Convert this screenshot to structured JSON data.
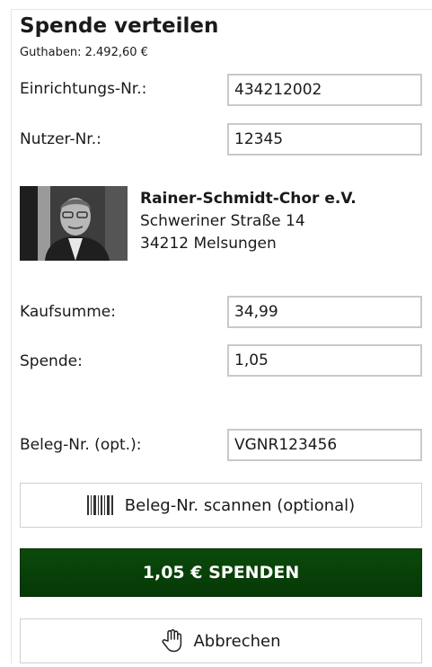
{
  "header": {
    "title": "Spende verteilen",
    "balance": "Guthaben: 2.492,60 €"
  },
  "fields": {
    "facility_label": "Einrichtungs-Nr.:",
    "facility_value": "434212002",
    "user_label": "Nutzer-Nr.:",
    "user_value": "12345",
    "purchase_label": "Kaufsumme:",
    "purchase_value": "34,99",
    "donation_label": "Spende:",
    "donation_value": "1,05",
    "receipt_label": "Beleg-Nr. (opt.):",
    "receipt_value": "VGNR123456"
  },
  "organization": {
    "name": "Rainer-Schmidt-Chor e.V.",
    "street": "Schweriner Straße 14",
    "city": "34212 Melsungen"
  },
  "buttons": {
    "scan_label": "Beleg-Nr. scannen (optional)",
    "donate_label": "1,05 € SPENDEN",
    "cancel_label": "Abbrechen"
  },
  "icons": {
    "scan": "barcode-icon",
    "cancel": "hand-pointer-icon"
  },
  "colors": {
    "donate_button": "#063806",
    "field_border": "#c9c9c9"
  }
}
